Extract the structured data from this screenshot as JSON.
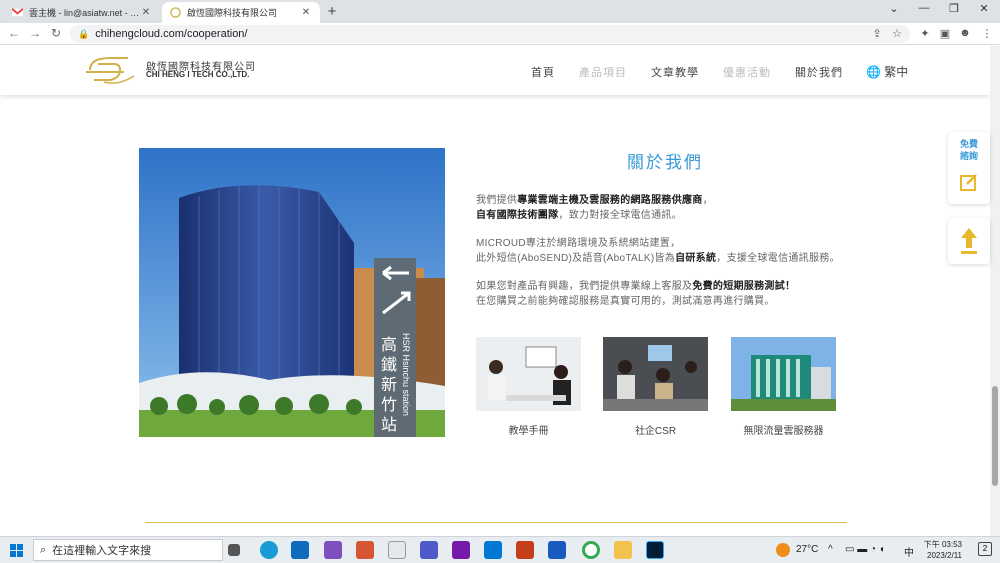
{
  "browser": {
    "tabs": [
      {
        "title": "雲主機 - lin@asiatw.net - 盈釵科",
        "active": false
      },
      {
        "title": "啟恆國際科技有限公司",
        "active": true
      }
    ],
    "new_tab": "+",
    "controls": {
      "minimize": "—",
      "maximize": "❐",
      "close": "✕",
      "dropdown": "⌄"
    },
    "url": "chihengcloud.com/cooperation/"
  },
  "header": {
    "brand_cn": "啟恆國際科技有限公司",
    "brand_en": "CHI HENG I TECH CO.,LTD.",
    "nav": [
      {
        "label": "首頁",
        "dim": false
      },
      {
        "label": "產品項目",
        "dim": true
      },
      {
        "label": "文章教學",
        "dim": false
      },
      {
        "label": "優惠活動",
        "dim": true
      },
      {
        "label": "關於我們",
        "dim": false
      }
    ],
    "lang": "繁中"
  },
  "about": {
    "title": "關於我們",
    "p1_pre": "我們提供",
    "p1_bold": "專業雲端主機及雲服務的網路服務供應商",
    "p1_post": "，",
    "p2_bold": "自有國際技術團隊",
    "p2_post": "，致力對接全球電信通訊。",
    "p3": "MICROUD專注於網路環境及系統網站建置，",
    "p4_pre": "此外短信(AboSEND)及語音(AboTALK)皆為",
    "p4_bold": "自研系統",
    "p4_post": "，支援全球電信通訊服務。",
    "p5_pre": "如果您對產品有興趣，我們提供專業線上客服及",
    "p5_bold": "免費的短期服務測試！",
    "p6": "在您購買之前能夠確認服務是真實可用的，測試滿意再進行購買。",
    "cards": [
      {
        "caption": "教學手冊"
      },
      {
        "caption": "社企CSR"
      },
      {
        "caption": "無限流量雲服務器"
      }
    ],
    "sign_text": [
      "高",
      "鐵",
      "新",
      "竹",
      "站"
    ],
    "sign_en": "HSR Hsinchu station"
  },
  "side": {
    "consult": "免費諮詢"
  },
  "taskbar": {
    "search_placeholder": "在這裡輸入文字來搜",
    "weather": "27°C",
    "ime": "中",
    "time": "下午 03:53",
    "date": "2023/2/11",
    "notif": "2"
  },
  "colors": {
    "accent": "#3a9ad9",
    "gold": "#e0c060"
  }
}
